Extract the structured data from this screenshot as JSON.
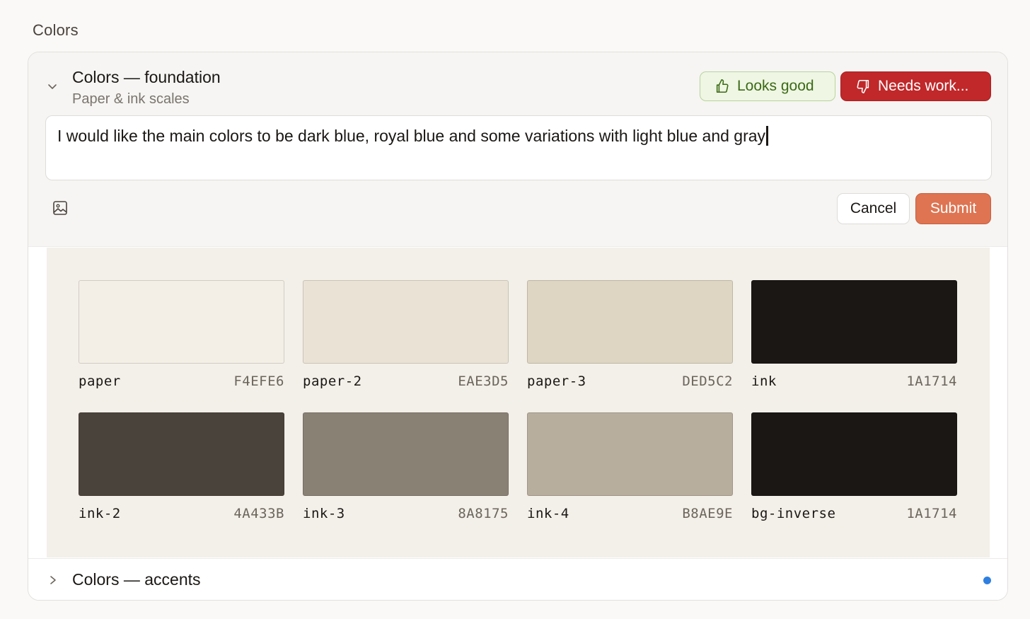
{
  "page": {
    "section_title": "Colors"
  },
  "card": {
    "title": "Colors — foundation",
    "subtitle": "Paper & ink scales",
    "looks_good_label": "Looks good",
    "needs_work_label": "Needs work...",
    "feedback_value": "I would like the main colors to be dark blue, royal blue and some variations with light blue and gray",
    "cancel_label": "Cancel",
    "submit_label": "Submit"
  },
  "swatches": [
    {
      "name": "paper",
      "hex": "F4EFE6",
      "color": "#F4EFE6"
    },
    {
      "name": "paper-2",
      "hex": "EAE3D5",
      "color": "#EAE3D5"
    },
    {
      "name": "paper-3",
      "hex": "DED5C2",
      "color": "#DED5C2"
    },
    {
      "name": "ink",
      "hex": "1A1714",
      "color": "#1A1714"
    },
    {
      "name": "ink-2",
      "hex": "4A433B",
      "color": "#4A433B"
    },
    {
      "name": "ink-3",
      "hex": "8A8175",
      "color": "#8A8175"
    },
    {
      "name": "ink-4",
      "hex": "B8AE9E",
      "color": "#B8AE9E"
    },
    {
      "name": "bg-inverse",
      "hex": "1A1714",
      "color": "#1A1714"
    }
  ],
  "accents": {
    "title": "Colors — accents",
    "dot_color": "#2f7fe0"
  },
  "colors": {
    "good_bg": "#eff6e4",
    "good_text": "#3b6a14",
    "bad_bg": "#c0282a",
    "submit_bg": "#de7452"
  }
}
